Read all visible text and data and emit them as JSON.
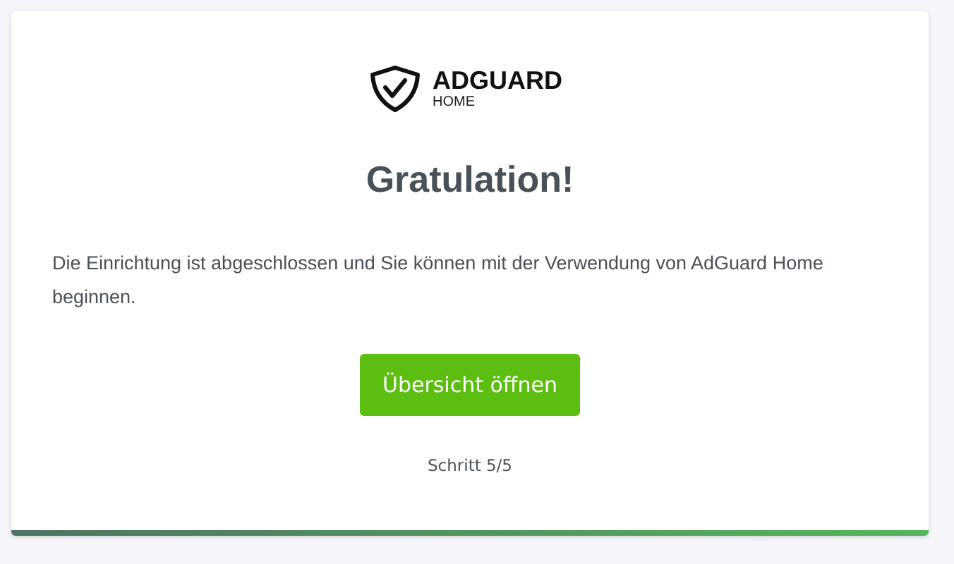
{
  "logo": {
    "name": "ADGUARD",
    "subtitle": "HOME"
  },
  "title": "Gratulation!",
  "message": "Die Einrichtung ist abgeschlossen und Sie können mit der Verwendung von AdGuard Home beginnen.",
  "button": "Übersicht öffnen",
  "step": "Schritt 5/5",
  "progress": {
    "level": 1
  }
}
